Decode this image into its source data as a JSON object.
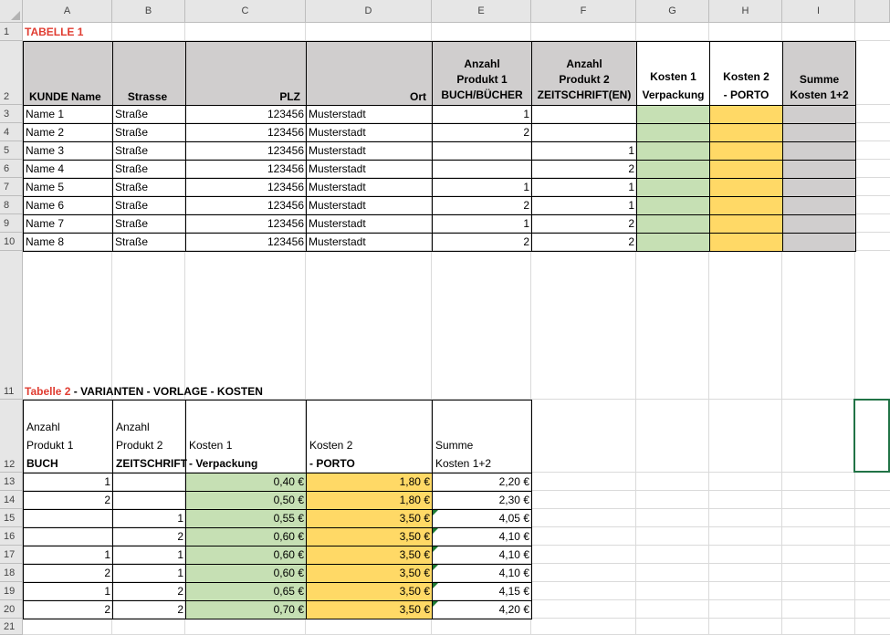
{
  "columns": [
    "A",
    "B",
    "C",
    "D",
    "E",
    "F",
    "G",
    "H",
    "I"
  ],
  "rows": [
    "1",
    "2",
    "3",
    "4",
    "5",
    "6",
    "7",
    "8",
    "9",
    "10",
    "11",
    "12",
    "13",
    "14",
    "15",
    "16",
    "17",
    "18",
    "19",
    "20",
    "21"
  ],
  "colors": {
    "green": "#c6e0b4",
    "yellow": "#ffd966",
    "gray": "#d0cece",
    "red_title": "#e03c31",
    "selection": "#217346"
  },
  "table1": {
    "title": "TABELLE 1",
    "headers": {
      "kunde": "KUNDE Name",
      "strasse": "Strasse",
      "plz": "PLZ",
      "ort": "Ort",
      "produkt1": [
        "Anzahl",
        "Produkt 1",
        "BUCH/BÜCHER"
      ],
      "produkt2": [
        "Anzahl",
        "Produkt 2",
        "ZEITSCHRIFT(EN)"
      ],
      "kosten1": [
        "Kosten 1",
        "Verpackung"
      ],
      "kosten2": [
        "Kosten 2",
        "- PORTO"
      ],
      "summe": [
        "Summe",
        "Kosten 1+2"
      ]
    },
    "rows": [
      {
        "name": "Name 1",
        "strasse": "Straße",
        "plz": "123456",
        "ort": "Musterstadt",
        "p1": "1",
        "p2": ""
      },
      {
        "name": "Name 2",
        "strasse": "Straße",
        "plz": "123456",
        "ort": "Musterstadt",
        "p1": "2",
        "p2": ""
      },
      {
        "name": "Name 3",
        "strasse": "Straße",
        "plz": "123456",
        "ort": "Musterstadt",
        "p1": "",
        "p2": "1"
      },
      {
        "name": "Name 4",
        "strasse": "Straße",
        "plz": "123456",
        "ort": "Musterstadt",
        "p1": "",
        "p2": "2"
      },
      {
        "name": "Name 5",
        "strasse": "Straße",
        "plz": "123456",
        "ort": "Musterstadt",
        "p1": "1",
        "p2": "1"
      },
      {
        "name": "Name 6",
        "strasse": "Straße",
        "plz": "123456",
        "ort": "Musterstadt",
        "p1": "2",
        "p2": "1"
      },
      {
        "name": "Name 7",
        "strasse": "Straße",
        "plz": "123456",
        "ort": "Musterstadt",
        "p1": "1",
        "p2": "2"
      },
      {
        "name": "Name 8",
        "strasse": "Straße",
        "plz": "123456",
        "ort": "Musterstadt",
        "p1": "2",
        "p2": "2"
      }
    ]
  },
  "table2": {
    "title_red": "Tabelle 2",
    "title_rest": " - VARIANTEN - VORLAGE - KOSTEN",
    "headers": {
      "produkt1": [
        "Anzahl",
        "Produkt 1",
        "BUCH"
      ],
      "produkt2": [
        "Anzahl",
        "Produkt 2",
        "ZEITSCHRIFT"
      ],
      "kosten1": [
        "Kosten 1",
        "- Verpackung"
      ],
      "kosten2": [
        "Kosten 2",
        " - PORTO"
      ],
      "summe": [
        "Summe",
        "Kosten 1+2"
      ]
    },
    "rows": [
      {
        "p1": "1",
        "p2": "",
        "k1": "0,40 €",
        "k2": "1,80 €",
        "sum": "2,20 €",
        "flag": false
      },
      {
        "p1": "2",
        "p2": "",
        "k1": "0,50 €",
        "k2": "1,80 €",
        "sum": "2,30 €",
        "flag": false
      },
      {
        "p1": "",
        "p2": "1",
        "k1": "0,55 €",
        "k2": "3,50 €",
        "sum": "4,05 €",
        "flag": true
      },
      {
        "p1": "",
        "p2": "2",
        "k1": "0,60 €",
        "k2": "3,50 €",
        "sum": "4,10 €",
        "flag": true
      },
      {
        "p1": "1",
        "p2": "1",
        "k1": "0,60 €",
        "k2": "3,50 €",
        "sum": "4,10 €",
        "flag": true
      },
      {
        "p1": "2",
        "p2": "1",
        "k1": "0,60 €",
        "k2": "3,50 €",
        "sum": "4,10 €",
        "flag": true
      },
      {
        "p1": "1",
        "p2": "2",
        "k1": "0,65 €",
        "k2": "3,50 €",
        "sum": "4,15 €",
        "flag": true
      },
      {
        "p1": "2",
        "p2": "2",
        "k1": "0,70 €",
        "k2": "3,50 €",
        "sum": "4,20 €",
        "flag": true
      }
    ]
  }
}
